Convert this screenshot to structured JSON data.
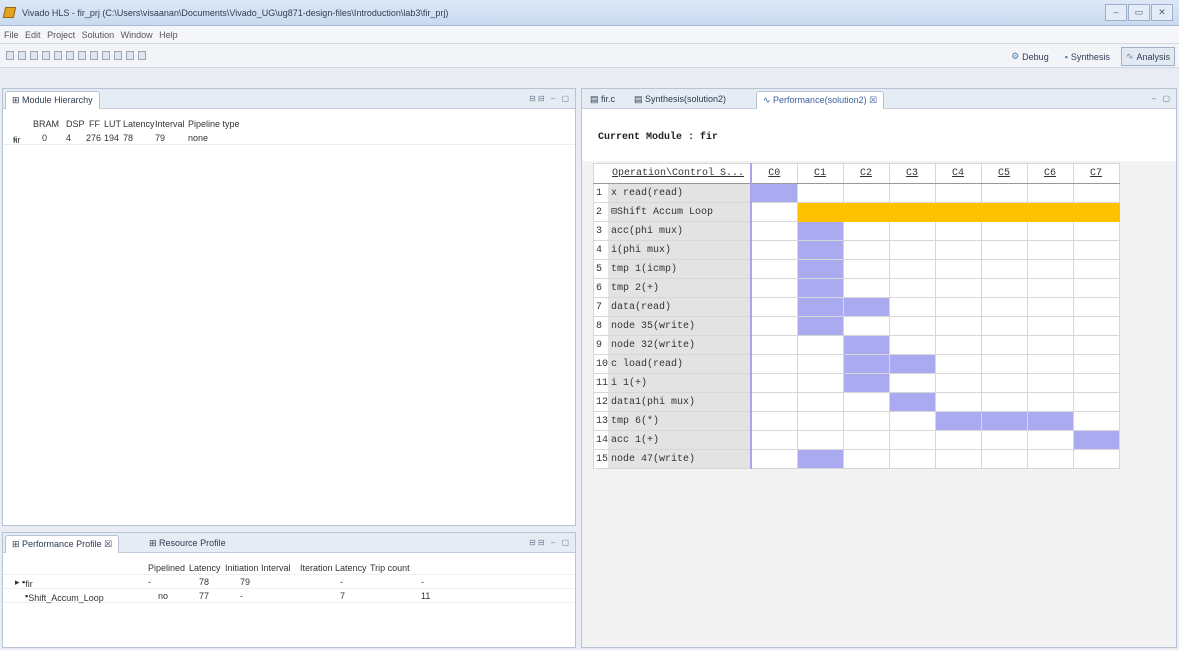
{
  "window": {
    "title": "Vivado HLS - fir_prj (C:\\Users\\visaanan\\Documents\\Vivado_UG\\ug871-design-files\\Introduction\\lab3\\fir_prj)",
    "buttons": [
      "–",
      "▭",
      "✕"
    ]
  },
  "menu": [
    "File",
    "Edit",
    "Project",
    "Solution",
    "Window",
    "Help"
  ],
  "perspectives": [
    {
      "label": "Debug",
      "icon": "bug-icon"
    },
    {
      "label": "Synthesis",
      "icon": "chip-icon"
    },
    {
      "label": "Analysis",
      "icon": "chart-icon"
    }
  ],
  "module_hierarchy": {
    "tab": "Module Hierarchy",
    "columns": [
      "BRAM",
      "DSP",
      "FF",
      "LUT",
      "Latency",
      "Interval",
      "Pipeline type"
    ],
    "rows": [
      {
        "name": "fir",
        "bram": "0",
        "dsp": "4",
        "ff": "276",
        "lut": "194",
        "latency": "78",
        "interval": "79",
        "pipeline": "none"
      }
    ]
  },
  "profile": {
    "tabs": [
      "Performance Profile",
      "Resource Profile"
    ],
    "columns": [
      "Pipelined",
      "Latency",
      "Initiation Interval",
      "Iteration Latency",
      "Trip count"
    ],
    "rows": [
      {
        "name": "fir",
        "pipelined": "-",
        "latency": "78",
        "ii": "79",
        "iter": "-",
        "trip": "-"
      },
      {
        "name": "Shift_Accum_Loop",
        "pipelined": "no",
        "latency": "77",
        "ii": "-",
        "iter": "7",
        "trip": "11"
      }
    ]
  },
  "editor": {
    "tabs": [
      "fir.c",
      "Synthesis(solution2)",
      "Performance(solution2)"
    ],
    "current_module": "Current Module : fir",
    "op_header": "Operation\\Control S...",
    "cycles": [
      "C0",
      "C1",
      "C2",
      "C3",
      "C4",
      "C5",
      "C6",
      "C7"
    ],
    "operations": [
      {
        "n": "1",
        "op": "x read(read)",
        "cells": [
          0
        ]
      },
      {
        "n": "2",
        "op": "⊟Shift Accum Loop",
        "loop": [
          1,
          7
        ]
      },
      {
        "n": "3",
        "op": "acc(phi mux)",
        "cells": [
          1
        ]
      },
      {
        "n": "4",
        "op": "i(phi mux)",
        "cells": [
          1
        ]
      },
      {
        "n": "5",
        "op": "tmp 1(icmp)",
        "cells": [
          1
        ]
      },
      {
        "n": "6",
        "op": "tmp 2(+)",
        "cells": [
          1
        ]
      },
      {
        "n": "7",
        "op": "data(read)",
        "cells": [
          1,
          2
        ]
      },
      {
        "n": "8",
        "op": "node 35(write)",
        "cells": [
          1
        ]
      },
      {
        "n": "9",
        "op": "node 32(write)",
        "cells": [
          2
        ]
      },
      {
        "n": "10",
        "op": "c load(read)",
        "cells": [
          2,
          3
        ]
      },
      {
        "n": "11",
        "op": "i 1(+)",
        "cells": [
          2
        ]
      },
      {
        "n": "12",
        "op": "data1(phi mux)",
        "cells": [
          3
        ]
      },
      {
        "n": "13",
        "op": "tmp 6(*)",
        "cells": [
          4,
          5,
          6
        ]
      },
      {
        "n": "14",
        "op": "acc 1(+)",
        "cells": [
          7
        ]
      },
      {
        "n": "15",
        "op": "node 47(write)",
        "cells": [
          1
        ]
      }
    ]
  }
}
